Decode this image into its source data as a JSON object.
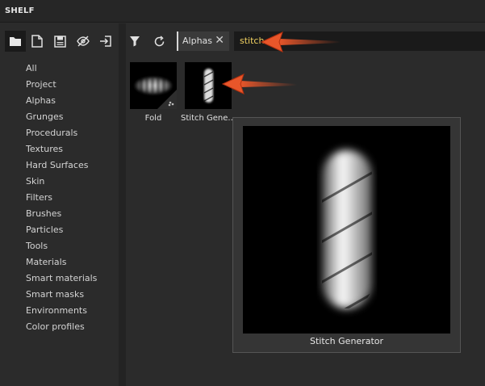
{
  "window": {
    "title": "SHELF"
  },
  "toolbar": {
    "icons": [
      "folder-icon",
      "new-document-icon",
      "save-icon",
      "hide-icon",
      "import-icon"
    ]
  },
  "categories": [
    "All",
    "Project",
    "Alphas",
    "Grunges",
    "Procedurals",
    "Textures",
    "Hard Surfaces",
    "Skin",
    "Filters",
    "Brushes",
    "Particles",
    "Tools",
    "Materials",
    "Smart materials",
    "Smart masks",
    "Environments",
    "Color profiles"
  ],
  "filter": {
    "tag": "Alphas",
    "close": "✕",
    "search_value": "stitch"
  },
  "assets": [
    {
      "name": "Fold"
    },
    {
      "name": "Stitch Gene..."
    }
  ],
  "preview": {
    "caption": "Stitch Generator"
  },
  "colors": {
    "accent": "#e8562a",
    "search_text": "#f0d060"
  }
}
